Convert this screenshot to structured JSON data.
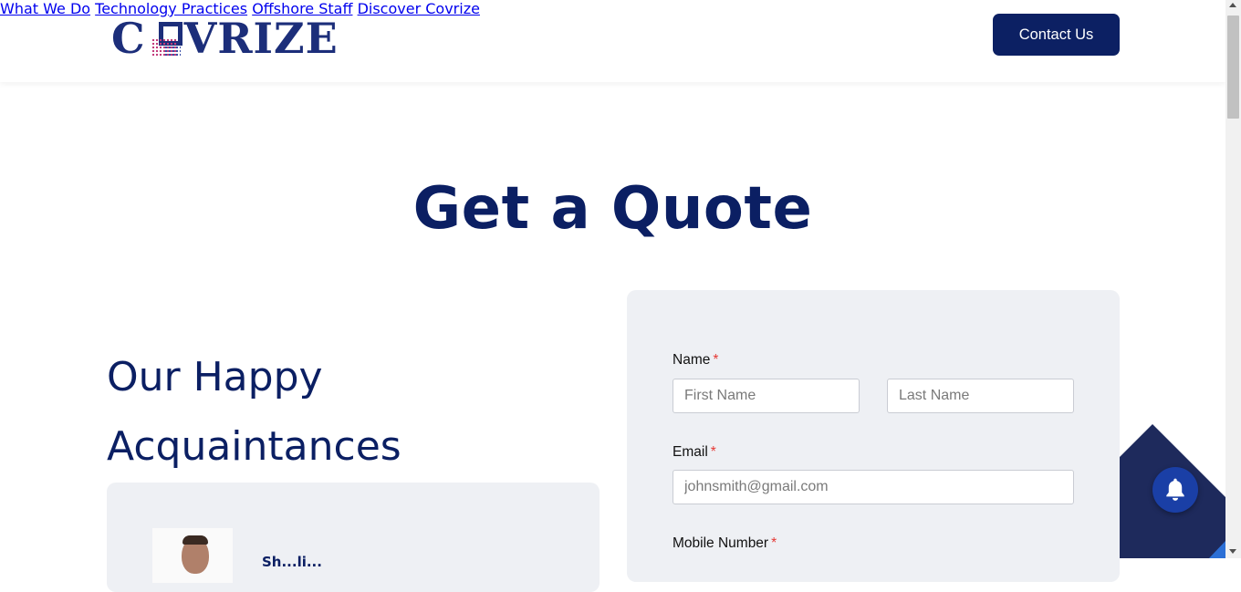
{
  "header": {
    "logo_text_left": "C",
    "logo_text_right": "VRIZE",
    "nav": [
      {
        "label": "What We Do"
      },
      {
        "label": "Technology Practices"
      },
      {
        "label": "Offshore Staff"
      },
      {
        "label": "Discover Covrize"
      }
    ],
    "contact_label": "Contact Us"
  },
  "main": {
    "title_regular": "Get a ",
    "title_bold": "Quote",
    "left_heading_line1": "Our Happy",
    "left_heading_line2": "Acquaintances",
    "testimonial_name_partial": "Sh...li..."
  },
  "form": {
    "name_label": "Name",
    "required_mark": "*",
    "first_name_placeholder": "First Name",
    "last_name_placeholder": "Last Name",
    "email_label": "Email",
    "email_placeholder": "johnsmith@gmail.com",
    "mobile_label": "Mobile Number"
  },
  "widgets": {
    "notification_icon": "bell-icon"
  },
  "colors": {
    "brand_navy": "#0c2063",
    "card_bg": "#eef0f4",
    "required_red": "#e53935",
    "bell_blue": "#1a3fa6"
  }
}
